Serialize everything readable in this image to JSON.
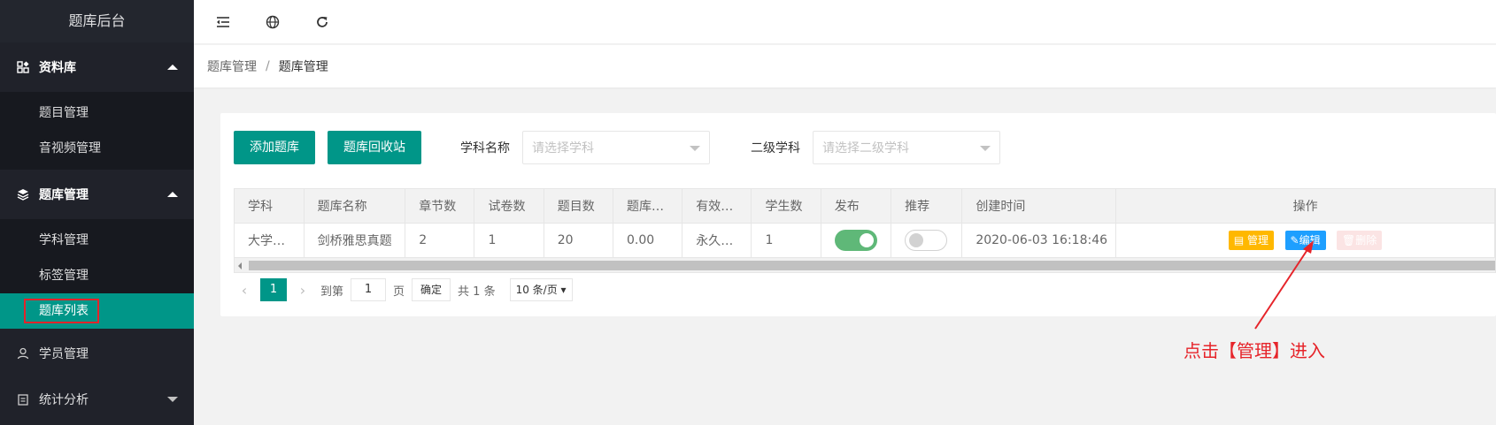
{
  "sidebar": {
    "brand": "题库后台",
    "groups": [
      {
        "label": "资料库",
        "items": [
          "题目管理",
          "音视频管理"
        ]
      },
      {
        "label": "题库管理",
        "items": [
          "学科管理",
          "标签管理",
          "题库列表"
        ]
      }
    ],
    "plain": [
      {
        "label": "学员管理"
      },
      {
        "label": "统计分析"
      }
    ],
    "active_item": "题库列表"
  },
  "topbar": {
    "icons": [
      "menu-fold-icon",
      "globe-icon",
      "refresh-icon"
    ]
  },
  "breadcrumb": {
    "parent": "题库管理",
    "separator": "/",
    "current": "题库管理"
  },
  "toolbar": {
    "add_label": "添加题库",
    "recycle_label": "题库回收站",
    "subject_label": "学科名称",
    "subject_placeholder": "请选择学科",
    "sub_subject_label": "二级学科",
    "sub_subject_placeholder": "请选择二级学科"
  },
  "table": {
    "headers": [
      "学科",
      "题库名称",
      "章节数",
      "试卷数",
      "题目数",
      "题库…",
      "有效…",
      "学生数",
      "发布",
      "推荐",
      "创建时间",
      "操作"
    ],
    "rows": [
      {
        "subject": "大学…",
        "name": "剑桥雅思真题",
        "chapters": "2",
        "papers": "1",
        "questions": "20",
        "price": "0.00",
        "validity": "永久…",
        "students": "1",
        "published": true,
        "recommended": false,
        "created": "2020-06-03 16:18:46"
      }
    ],
    "ops": {
      "manage": "管理",
      "edit": "编辑",
      "delete": "删除"
    }
  },
  "pager": {
    "current": "1",
    "goto_label": "到第",
    "goto_value": "1",
    "page_unit": "页",
    "confirm": "确定",
    "total": "共 1 条",
    "page_size": "10 条/页"
  },
  "annotation": {
    "text": "点击【管理】进入",
    "color": "#e6242a"
  },
  "colors": {
    "primary": "#009688",
    "sidebar_bg": "#20222a",
    "warn": "#ffb800",
    "normal": "#1e9fff",
    "switch_on": "#5fb878"
  }
}
